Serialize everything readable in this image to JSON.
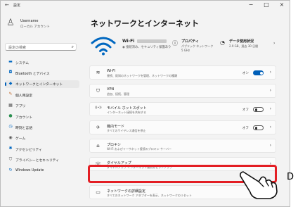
{
  "window": {
    "title": "設定",
    "back": "←",
    "minimize": "−",
    "maximize": "□",
    "close": "×"
  },
  "user": {
    "name": "Username",
    "sub": "ローカル アカウント"
  },
  "search": {
    "placeholder": "設定の検索"
  },
  "nav": [
    {
      "label": "システム",
      "icon": "▬",
      "icon_name": "monitor-icon",
      "color": "#0067c0"
    },
    {
      "label": "Bluetooth とデバイス",
      "icon": "◘",
      "icon_name": "bluetooth-icon",
      "color": "#0067c0"
    },
    {
      "label": "ネットワークとインターネット",
      "icon": "◆",
      "icon_name": "network-icon",
      "color": "#0067c0",
      "active": true
    },
    {
      "label": "個人用設定",
      "icon": "✎",
      "icon_name": "brush-icon",
      "color": "#c06a2b"
    },
    {
      "label": "アプリ",
      "icon": "▦",
      "icon_name": "apps-icon",
      "color": "#555555"
    },
    {
      "label": "アカウント",
      "icon": "●",
      "icon_name": "account-icon",
      "color": "#2a8f4f"
    },
    {
      "label": "時刻と言語",
      "icon": "◷",
      "icon_name": "time-language-icon",
      "color": "#0067c0"
    },
    {
      "label": "ゲーム",
      "icon": "◉",
      "icon_name": "gaming-icon",
      "color": "#555555"
    },
    {
      "label": "アクセシビリティ",
      "icon": "✱",
      "icon_name": "accessibility-icon",
      "color": "#0067c0"
    },
    {
      "label": "プライバシーとセキュリティ",
      "icon": "⛉",
      "icon_name": "shield-icon",
      "color": "#555555"
    },
    {
      "label": "Windows Update",
      "icon": "↻",
      "icon_name": "update-icon",
      "color": "#0067c0"
    }
  ],
  "main": {
    "title": "ネットワークとインターネット",
    "hero": {
      "title": "Wi-Fi",
      "sub": "◉ 接続済み、セキュリティ保護あり",
      "properties": "プロパティ",
      "properties_sub": [
        "パブリック ネットワーク",
        "5 GHz"
      ],
      "usage": "データ使用状況",
      "usage_sub": "2.9 GB、過去 30 日間"
    },
    "rows": [
      {
        "icon": "≋",
        "icon_name": "wifi-icon",
        "title": "Wi-Fi",
        "sub": "接続、既知のネットワークを管理、ネットワークの種類",
        "state": "オン",
        "toggle": "on",
        "name": "wifi-row"
      },
      {
        "icon": "⛉",
        "icon_name": "vpn-shield-icon",
        "title": "VPN",
        "sub": "追加、接続、管理",
        "name": "vpn-row"
      },
      {
        "icon": "((•))",
        "icon_name": "mobile-hotspot-icon",
        "title": "モバイル ホットスポット",
        "sub": "インターネット接続を共有する",
        "state": "オフ",
        "toggle": "off",
        "name": "mobile-hotspot-row"
      },
      {
        "icon": "✈",
        "icon_name": "airplane-icon",
        "title": "機内モード",
        "sub": "すべてのワイヤレス通信を停止",
        "state": "オフ",
        "toggle": "off",
        "name": "airplane-mode-row"
      },
      {
        "icon": "⌂",
        "icon_name": "proxy-icon",
        "title": "プロキシ",
        "sub": "Wi-Fi およびイーサネット接続のプロキシ サーバー",
        "name": "proxy-row"
      },
      {
        "icon": "☏",
        "icon_name": "dialup-icon",
        "title": "ダイヤルアップ",
        "sub": "ダイヤルアップ インターネット接続をセットアップ",
        "name": "dialup-row"
      },
      {
        "icon": "▭",
        "icon_name": "advanced-network-icon",
        "title": "ネットワークの詳細設定",
        "sub": "すべてのネットワーク アダプターを表示、ネットワークのリセット",
        "name": "advanced-network-row"
      }
    ]
  },
  "marker": "D",
  "colors": {
    "accent": "#005fb8",
    "highlight": "#e31e24"
  }
}
